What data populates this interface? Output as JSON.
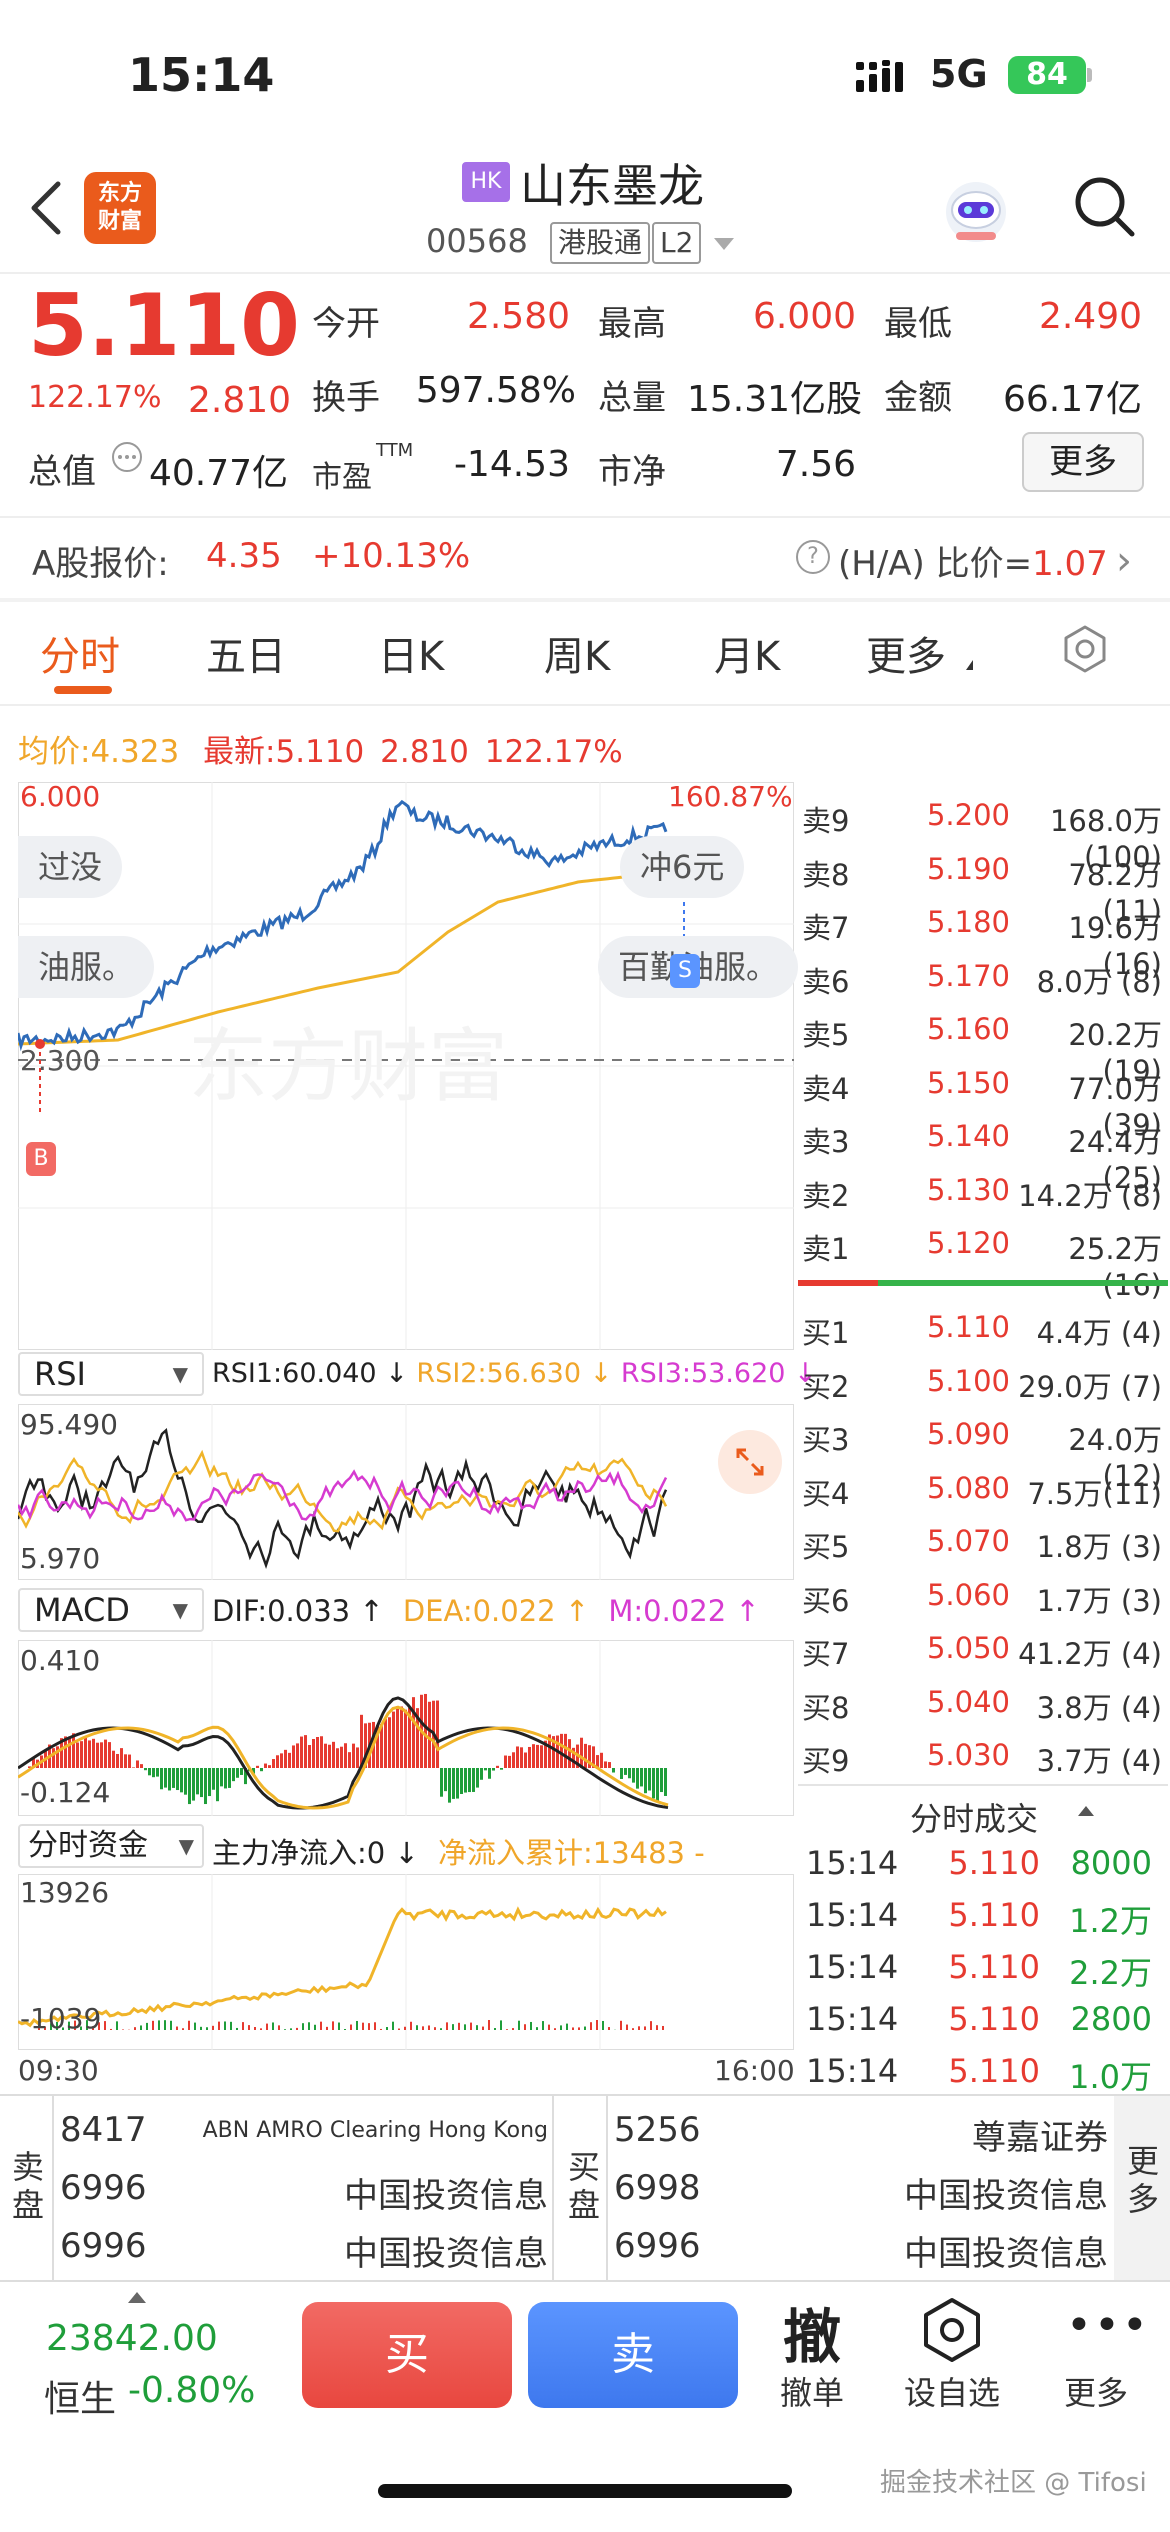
{
  "status": {
    "time": "15:14",
    "network": "5G",
    "battery": "84"
  },
  "header": {
    "logo_line1": "东方",
    "logo_line2": "财富",
    "market_badge": "HK",
    "stock_name": "山东墨龙",
    "stock_code": "00568",
    "tag_connect": "港股通",
    "tag_level": "L2"
  },
  "quote": {
    "price": "5.110",
    "change_pct": "122.17%",
    "change": "2.810",
    "open_label": "今开",
    "open": "2.580",
    "high_label": "最高",
    "high": "6.000",
    "low_label": "最低",
    "low": "2.490",
    "turnover_label": "换手",
    "turnover": "597.58%",
    "volume_label": "总量",
    "volume": "15.31亿股",
    "amount_label": "金额",
    "amount": "66.17亿",
    "mktcap_label": "总值",
    "mktcap": "40.77亿",
    "pe_label": "市盈",
    "pe_sup": "TTM",
    "pe": "-14.53",
    "pb_label": "市净",
    "pb": "7.56",
    "more_label": "更多"
  },
  "ashare": {
    "label": "A股报价:",
    "price": "4.35",
    "pct": "+10.13%",
    "ratio_label": "(H/A) 比价=",
    "ratio": "1.07"
  },
  "tabs": [
    {
      "label": "分时"
    },
    {
      "label": "五日"
    },
    {
      "label": "日K"
    },
    {
      "label": "周K"
    },
    {
      "label": "月K"
    },
    {
      "label": "更多"
    }
  ],
  "chart": {
    "avg_label": "均价:",
    "avg": "4.323",
    "latest_label": "最新:",
    "latest": "5.110",
    "latest_chg": "2.810",
    "latest_pct": "122.17%",
    "y_top": "6.000",
    "y_pct_top": "160.87%",
    "y_ref": "2.300",
    "pill_left_1": "过没",
    "pill_left_2": "油服。",
    "pill_right_1": "冲6元",
    "pill_right_2": "百勤油服。",
    "marker_b": "B",
    "marker_s": "S",
    "watermark": "东方财富",
    "time_start": "09:30",
    "time_end": "16:00"
  },
  "rsi": {
    "select": "RSI",
    "rsi1": "RSI1:60.040 ↓",
    "rsi2": "RSI2:56.630 ↓",
    "rsi3": "RSI3:53.620 ↓",
    "y_top": "95.490",
    "y_bottom": "5.970"
  },
  "macd": {
    "select": "MACD",
    "dif": "DIF:0.033 ↑",
    "dea": "DEA:0.022 ↑",
    "m": "M:0.022 ↑",
    "y_top": "0.410",
    "y_bottom": "-0.124"
  },
  "fund": {
    "select": "分时资金",
    "main": "主力净流入:0 ↓",
    "cum": "净流入累计:13483 -",
    "y_top": "13926",
    "y_bottom": "-1039"
  },
  "orderbook": {
    "asks": [
      {
        "label": "卖9",
        "price": "5.200",
        "vol": "168.0万(100)"
      },
      {
        "label": "卖8",
        "price": "5.190",
        "vol": "78.2万(11)"
      },
      {
        "label": "卖7",
        "price": "5.180",
        "vol": "19.6万(16)"
      },
      {
        "label": "卖6",
        "price": "5.170",
        "vol": "8.0万 (8)"
      },
      {
        "label": "卖5",
        "price": "5.160",
        "vol": "20.2万(19)"
      },
      {
        "label": "卖4",
        "price": "5.150",
        "vol": "77.0万(39)"
      },
      {
        "label": "卖3",
        "price": "5.140",
        "vol": "24.4万(25)"
      },
      {
        "label": "卖2",
        "price": "5.130",
        "vol": "14.2万 (8)"
      },
      {
        "label": "卖1",
        "price": "5.120",
        "vol": "25.2万(16)"
      }
    ],
    "bids": [
      {
        "label": "买1",
        "price": "5.110",
        "vol": "4.4万 (4)"
      },
      {
        "label": "买2",
        "price": "5.100",
        "vol": "29.0万 (7)"
      },
      {
        "label": "买3",
        "price": "5.090",
        "vol": "24.0万(12)"
      },
      {
        "label": "买4",
        "price": "5.080",
        "vol": "7.5万(11)"
      },
      {
        "label": "买5",
        "price": "5.070",
        "vol": "1.8万 (3)"
      },
      {
        "label": "买6",
        "price": "5.060",
        "vol": "1.7万 (3)"
      },
      {
        "label": "买7",
        "price": "5.050",
        "vol": "41.2万 (4)"
      },
      {
        "label": "买8",
        "price": "5.040",
        "vol": "3.8万 (4)"
      },
      {
        "label": "买9",
        "price": "5.030",
        "vol": "3.7万 (4)"
      }
    ]
  },
  "trades": {
    "title": "分时成交",
    "rows": [
      {
        "time": "15:14",
        "price": "5.110",
        "vol": "8000"
      },
      {
        "time": "15:14",
        "price": "5.110",
        "vol": "1.2万"
      },
      {
        "time": "15:14",
        "price": "5.110",
        "vol": "2.2万"
      },
      {
        "time": "15:14",
        "price": "5.110",
        "vol": "2800"
      },
      {
        "time": "15:14",
        "price": "5.110",
        "vol": "1.0万"
      }
    ]
  },
  "brokers": {
    "sell_label": "卖盘",
    "buy_label": "买盘",
    "more_label": "更多",
    "sell": [
      {
        "num": "8417",
        "name": "ABN AMRO Clearing Hong Kong"
      },
      {
        "num": "6996",
        "name": "中国投资信息"
      },
      {
        "num": "6996",
        "name": "中国投资信息"
      }
    ],
    "buy": [
      {
        "num": "5256",
        "name": "尊嘉证券"
      },
      {
        "num": "6998",
        "name": "中国投资信息"
      },
      {
        "num": "6996",
        "name": "中国投资信息"
      }
    ]
  },
  "bottom": {
    "index_value": "23842.00",
    "index_name": "恒生",
    "index_pct": "-0.80%",
    "buy": "买",
    "sell": "卖",
    "cancel_glyph": "撤",
    "cancel_label": "撤单",
    "watchlist_label": "设自选",
    "more_label": "更多",
    "watermark": "掘金技术社区 @ Tifosi"
  },
  "colors": {
    "up": "#e63a30",
    "down": "#1f9e3a",
    "line": "#2e6bb8",
    "avg": "#f0b429",
    "accent": "#ea5b1c"
  }
}
